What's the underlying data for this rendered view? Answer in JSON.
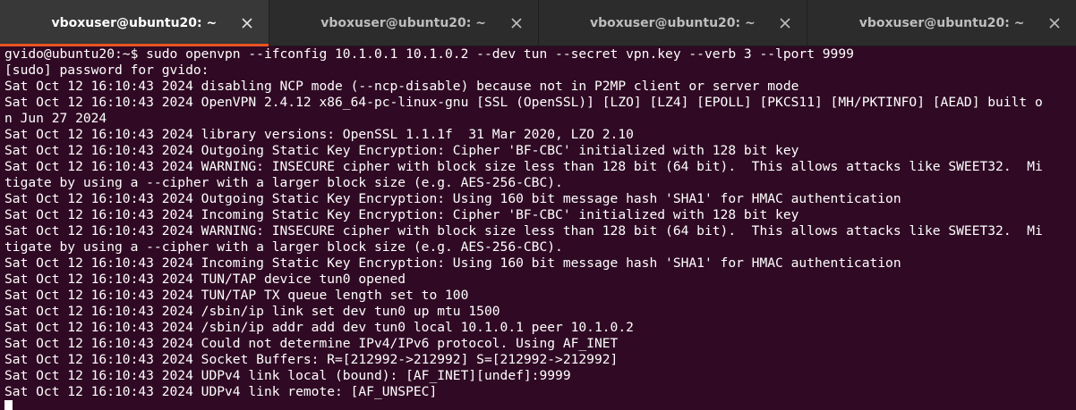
{
  "tabs": [
    {
      "label": "vboxuser@ubuntu20: ~",
      "active": true
    },
    {
      "label": "vboxuser@ubuntu20: ~",
      "active": false
    },
    {
      "label": "vboxuser@ubuntu20: ~",
      "active": false
    },
    {
      "label": "vboxuser@ubuntu20: ~",
      "active": false
    }
  ],
  "terminal": {
    "lines": [
      "gvido@ubuntu20:~$ sudo openvpn --ifconfig 10.1.0.1 10.1.0.2 --dev tun --secret vpn.key --verb 3 --lport 9999",
      "[sudo] password for gvido:",
      "Sat Oct 12 16:10:43 2024 disabling NCP mode (--ncp-disable) because not in P2MP client or server mode",
      "Sat Oct 12 16:10:43 2024 OpenVPN 2.4.12 x86_64-pc-linux-gnu [SSL (OpenSSL)] [LZO] [LZ4] [EPOLL] [PKCS11] [MH/PKTINFO] [AEAD] built o",
      "n Jun 27 2024",
      "Sat Oct 12 16:10:43 2024 library versions: OpenSSL 1.1.1f  31 Mar 2020, LZO 2.10",
      "Sat Oct 12 16:10:43 2024 Outgoing Static Key Encryption: Cipher 'BF-CBC' initialized with 128 bit key",
      "Sat Oct 12 16:10:43 2024 WARNING: INSECURE cipher with block size less than 128 bit (64 bit).  This allows attacks like SWEET32.  Mi",
      "tigate by using a --cipher with a larger block size (e.g. AES-256-CBC).",
      "Sat Oct 12 16:10:43 2024 Outgoing Static Key Encryption: Using 160 bit message hash 'SHA1' for HMAC authentication",
      "Sat Oct 12 16:10:43 2024 Incoming Static Key Encryption: Cipher 'BF-CBC' initialized with 128 bit key",
      "Sat Oct 12 16:10:43 2024 WARNING: INSECURE cipher with block size less than 128 bit (64 bit).  This allows attacks like SWEET32.  Mi",
      "tigate by using a --cipher with a larger block size (e.g. AES-256-CBC).",
      "Sat Oct 12 16:10:43 2024 Incoming Static Key Encryption: Using 160 bit message hash 'SHA1' for HMAC authentication",
      "Sat Oct 12 16:10:43 2024 TUN/TAP device tun0 opened",
      "Sat Oct 12 16:10:43 2024 TUN/TAP TX queue length set to 100",
      "Sat Oct 12 16:10:43 2024 /sbin/ip link set dev tun0 up mtu 1500",
      "Sat Oct 12 16:10:43 2024 /sbin/ip addr add dev tun0 local 10.1.0.1 peer 10.1.0.2",
      "Sat Oct 12 16:10:43 2024 Could not determine IPv4/IPv6 protocol. Using AF_INET",
      "Sat Oct 12 16:10:43 2024 Socket Buffers: R=[212992->212992] S=[212992->212992]",
      "Sat Oct 12 16:10:43 2024 UDPv4 link local (bound): [AF_INET][undef]:9999",
      "Sat Oct 12 16:10:43 2024 UDPv4 link remote: [AF_UNSPEC]"
    ]
  },
  "colors": {
    "terminal_bg": "#300a24",
    "terminal_fg": "#ffffff",
    "tabbar_bg": "#2c2c2c",
    "active_tab_bg": "#383838",
    "accent": "#e95420"
  },
  "icons": {
    "tab_close": "close-icon",
    "cursor": "block-cursor"
  }
}
